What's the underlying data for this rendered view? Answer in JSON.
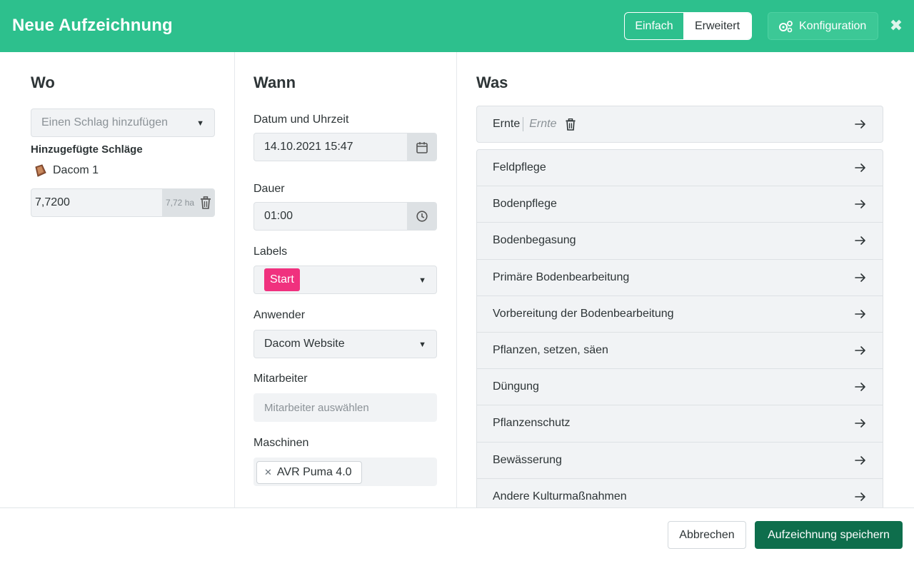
{
  "header": {
    "title": "Neue Aufzeichnung",
    "mode_simple": "Einfach",
    "mode_advanced": "Erweitert",
    "config_label": "Konfiguration",
    "close_symbol": "✖"
  },
  "wo": {
    "heading": "Wo",
    "field_select_placeholder": "Einen Schlag hinzufügen",
    "added_heading": "Hinzugefügte Schläge",
    "field_name": "Dacom 1",
    "area_value": "7,7200",
    "area_hint": "7,72 ha"
  },
  "wann": {
    "heading": "Wann",
    "datetime_label": "Datum und Uhrzeit",
    "datetime_value": "14.10.2021 15:47",
    "duration_label": "Dauer",
    "duration_value": "01:00",
    "labels_label": "Labels",
    "label_tag": "Start",
    "user_label": "Anwender",
    "user_value": "Dacom Website",
    "staff_label": "Mitarbeiter",
    "staff_placeholder": "Mitarbeiter auswählen",
    "machines_label": "Maschinen",
    "machine_chip": "AVR Puma 4.0"
  },
  "was": {
    "heading": "Was",
    "first_item": "Ernte",
    "first_item_placeholder": "Ernte",
    "items": [
      "Feldpflege",
      "Bodenpflege",
      "Bodenbegasung",
      "Primäre Bodenbearbeitung",
      "Vorbereitung der Bodenbearbeitung",
      "Pflanzen, setzen, säen",
      "Düngung",
      "Pflanzenschutz",
      "Bewässerung",
      "Andere Kulturmaßnahmen"
    ]
  },
  "footer": {
    "cancel_label": "Abbrechen",
    "save_label": "Aufzeichnung speichern"
  },
  "colors": {
    "header_bg": "#2dc08d",
    "save_bg": "#0e6e4c",
    "label_tag_bg": "#f0317e"
  }
}
